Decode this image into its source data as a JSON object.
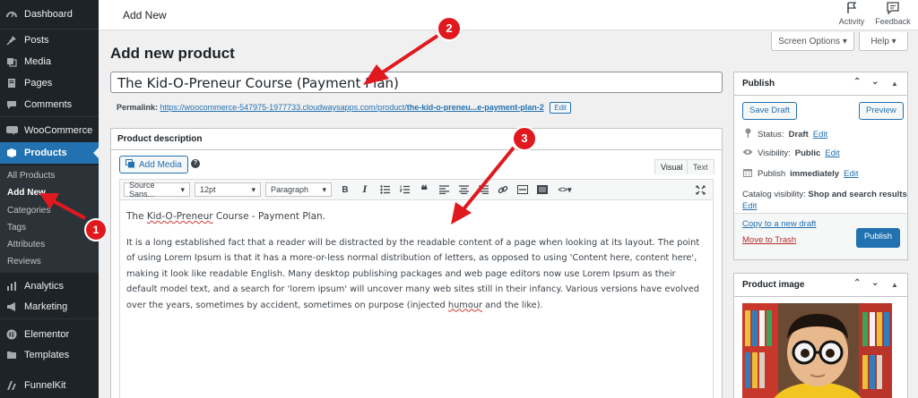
{
  "sidebar": {
    "items": [
      {
        "label": "Dashboard",
        "icon": "dashboard-icon"
      },
      {
        "label": "Posts",
        "icon": "pin-icon"
      },
      {
        "label": "Media",
        "icon": "media-icon"
      },
      {
        "label": "Pages",
        "icon": "page-icon"
      },
      {
        "label": "Comments",
        "icon": "comment-icon"
      },
      {
        "label": "WooCommerce",
        "icon": "woocommerce-icon"
      },
      {
        "label": "Products",
        "icon": "products-icon"
      },
      {
        "label": "Analytics",
        "icon": "bar-chart-icon"
      },
      {
        "label": "Marketing",
        "icon": "megaphone-icon"
      },
      {
        "label": "Elementor",
        "icon": "elementor-icon"
      },
      {
        "label": "Templates",
        "icon": "folder-icon"
      },
      {
        "label": "FunnelKit",
        "icon": "funnelkit-icon"
      }
    ],
    "submenu": [
      "All Products",
      "Add New",
      "Categories",
      "Tags",
      "Attributes",
      "Reviews"
    ],
    "current_submenu": "Add New"
  },
  "topbar": {
    "title": "Add New",
    "activity_label": "Activity",
    "feedback_label": "Feedback"
  },
  "screen_options_label": "Screen Options ▾",
  "help_label": "Help ▾",
  "page_title": "Add new product",
  "product": {
    "title": "The Kid-O-Preneur Course (Payment Plan)",
    "permalink_label": "Permalink:",
    "permalink_prefix": "https://woocommerce-547975-1977733.cloudwaysapps.com/product/",
    "permalink_slug": "the-kid-o-preneu...e-payment-plan-2",
    "permalink_edit": "Edit"
  },
  "editor": {
    "header": "Product description",
    "add_media": "Add Media",
    "tabs": [
      "Visual",
      "Text"
    ],
    "active_tab": "Visual",
    "font_family": "Source Sans...",
    "font_size": "12pt",
    "format": "Paragraph",
    "content": {
      "line1_a": "The ",
      "line1_squiggle": "Kid-O-Preneur",
      "line1_b": " Course - Payment Plan.",
      "para_a": "It is a long established fact that a reader will be distracted by the readable content of a page when looking at its layout. The point of using Lorem Ipsum is that it has a more-or-less normal distribution of letters, as opposed to using 'Content here, content here', making it look like readable English. Many desktop publishing packages and web page editors now use Lorem Ipsum as their default model text, and a search for 'lorem ipsum' will uncover many web sites still in their infancy. Various versions have evolved over the years, sometimes by accident, sometimes on purpose (injected ",
      "para_squiggle": "humour",
      "para_b": " and the like)."
    }
  },
  "publish": {
    "header": "Publish",
    "save_draft": "Save Draft",
    "preview": "Preview",
    "status_label": "Status:",
    "status_value": "Draft",
    "visibility_label": "Visibility:",
    "visibility_value": "Public",
    "publish_label": "Publish",
    "publish_value": "immediately",
    "edit": "Edit",
    "catalog_label": "Catalog visibility:",
    "catalog_value": "Shop and search results",
    "copy_draft": "Copy to a new draft",
    "trash": "Move to Trash",
    "publish_button": "Publish"
  },
  "product_image": {
    "header": "Product image"
  },
  "callouts": [
    "1",
    "2",
    "3"
  ],
  "colors": {
    "sidebar_bg": "#1d2327",
    "accent": "#2271b1",
    "annotation": "#e0191f"
  }
}
